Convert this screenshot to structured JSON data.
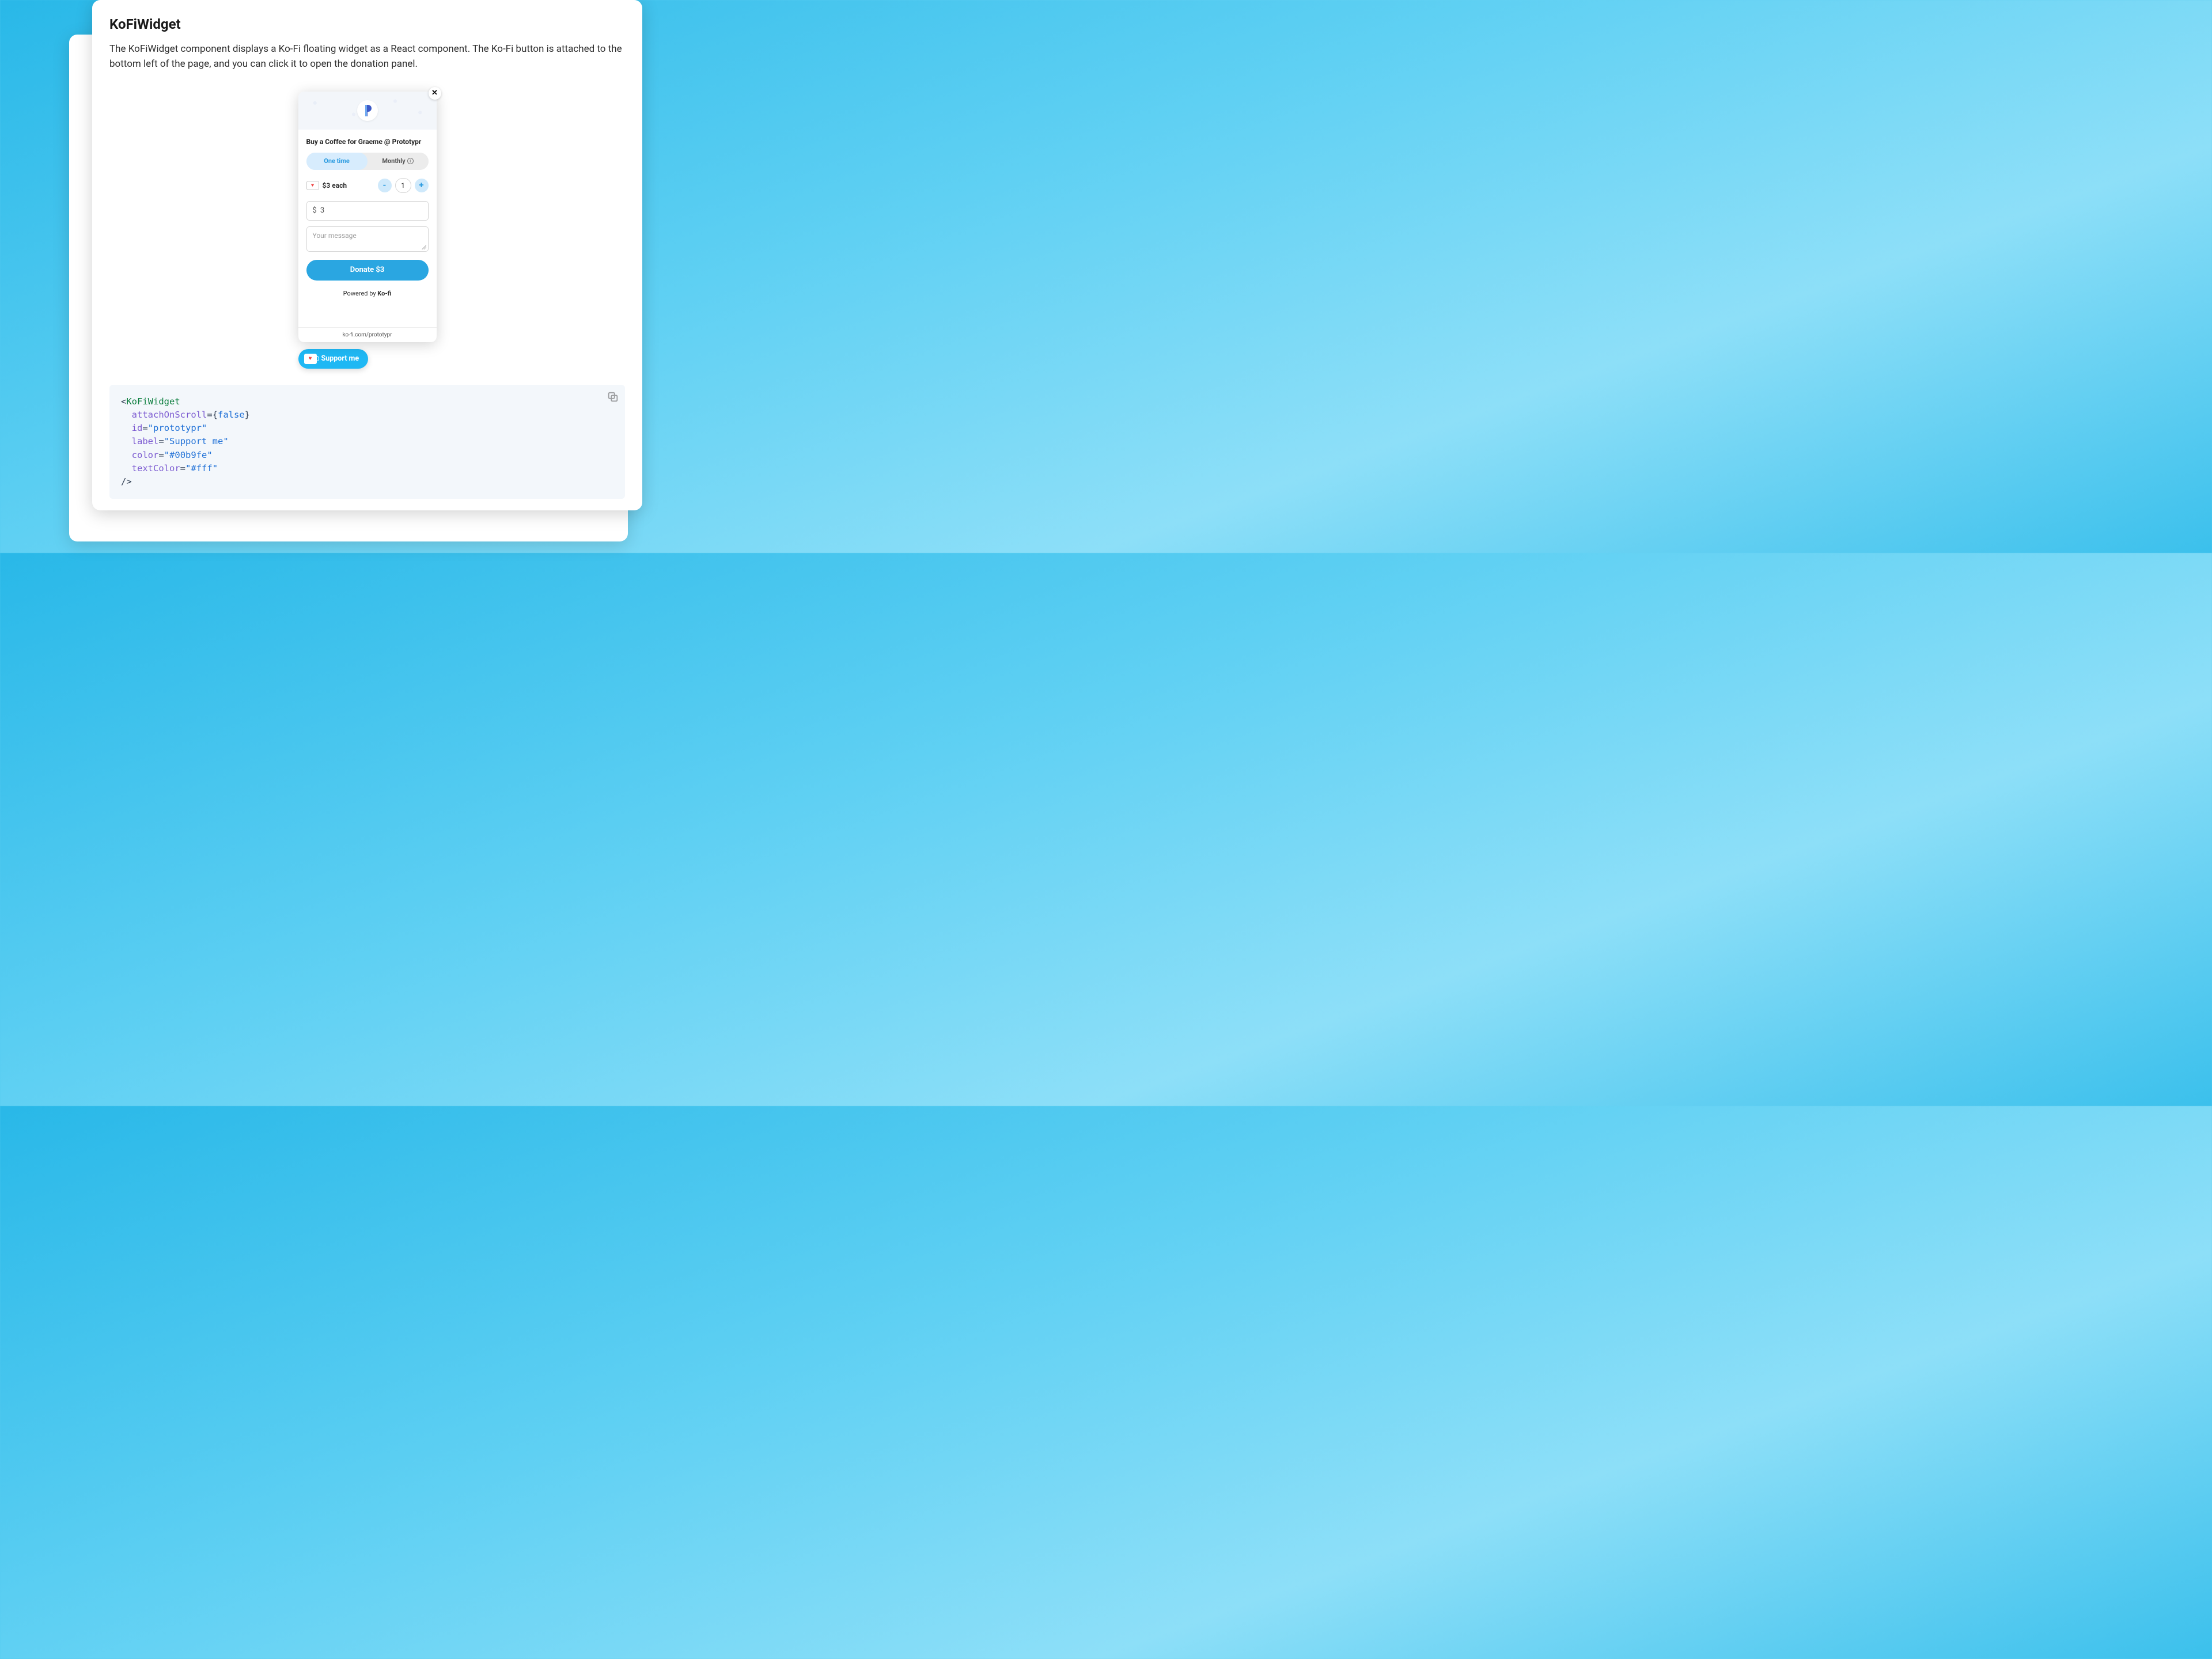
{
  "doc": {
    "title": "KoFiWidget",
    "intro": "The KoFiWidget component displays a Ko-Fi floating widget as a React component. The Ko-Fi button is attached to the bottom left of the page, and you can click it to open the donation panel."
  },
  "kofi": {
    "close_glyph": "✕",
    "title": "Buy a Coffee for Graeme @ Prototypr",
    "tab_one_time": "One time",
    "tab_monthly": "Monthly",
    "each_label": "$3 each",
    "qty_value": "1",
    "minus": "-",
    "plus": "+",
    "amount_prefix": "$",
    "amount_value": "3",
    "message_placeholder": "Your message",
    "donate_label": "Donate $3",
    "powered_prefix": "Powered by ",
    "powered_brand": "Ko-fi",
    "footer_url": "ko-fi.com/prototypr",
    "support_label": "Support me"
  },
  "code": {
    "component": "KoFiWidget",
    "props": {
      "attachOnScroll": "false",
      "id": "prototypr",
      "label": "Support me",
      "color": "#00b9fe",
      "textColor": "#fff"
    },
    "attr_attachOnScroll": "attachOnScroll",
    "attr_id": "id",
    "attr_label": "label",
    "attr_color": "color",
    "attr_textColor": "textColor"
  }
}
